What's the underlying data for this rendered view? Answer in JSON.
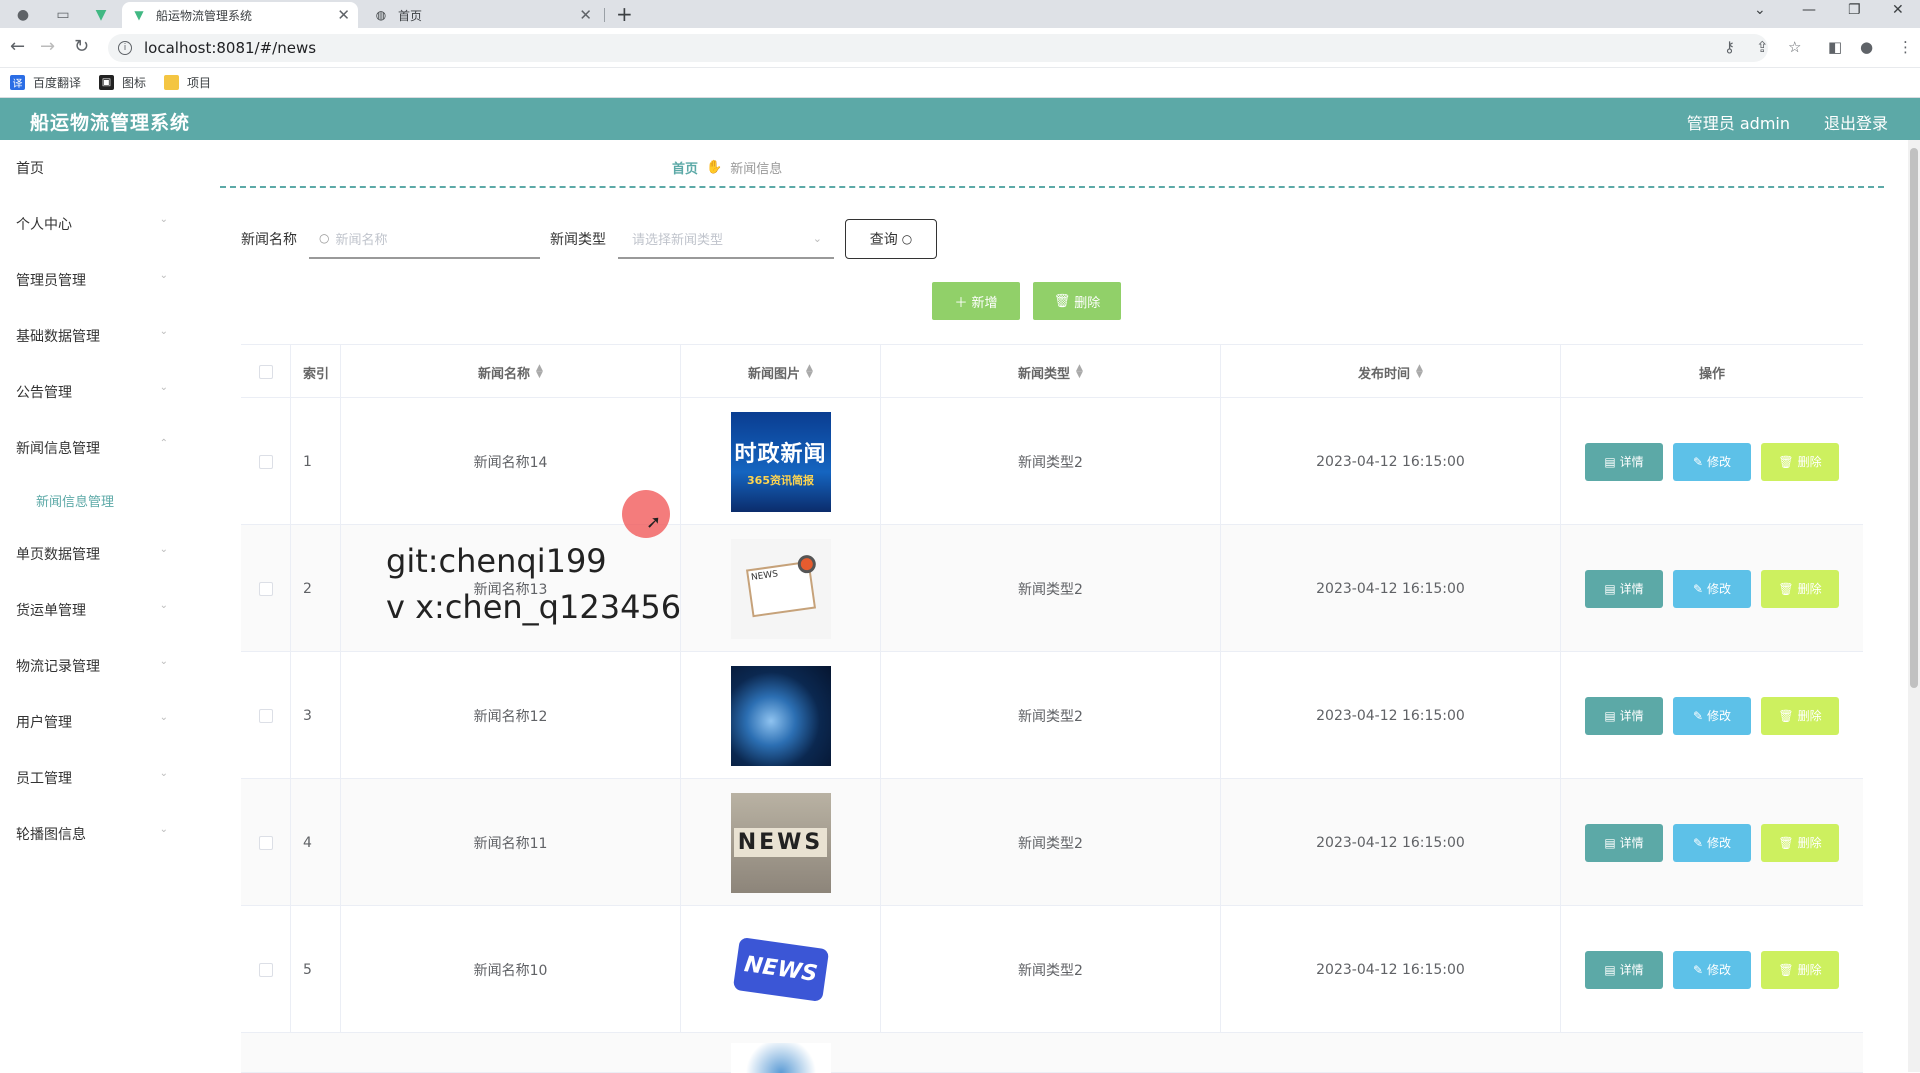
{
  "browser": {
    "active_tab_title": "船运物流管理系统",
    "second_tab_title": "首页",
    "url": "localhost:8081/#/news",
    "bookmarks": [
      "百度翻译",
      "图标",
      "项目"
    ]
  },
  "header": {
    "title": "船运物流管理系统",
    "admin": "管理员 admin",
    "logout": "退出登录"
  },
  "sidebar": {
    "items": [
      "首页",
      "个人中心",
      "管理员管理",
      "基础数据管理",
      "公告管理",
      "新闻信息管理",
      "单页数据管理",
      "货运单管理",
      "物流记录管理",
      "用户管理",
      "员工管理",
      "轮播图信息"
    ],
    "sub_item": "新闻信息管理"
  },
  "breadcrumb": {
    "home": "首页",
    "current": "新闻信息"
  },
  "search": {
    "name_label": "新闻名称",
    "name_placeholder": "新闻名称",
    "type_label": "新闻类型",
    "type_placeholder": "请选择新闻类型",
    "query_button": "查询"
  },
  "actions": {
    "add": "新增",
    "delete": "删除"
  },
  "table": {
    "headers": [
      "索引",
      "新闻名称",
      "新闻图片",
      "新闻类型",
      "发布时间",
      "操作"
    ],
    "rows": [
      {
        "index": "1",
        "name": "新闻名称14",
        "type": "新闻类型2",
        "time": "2023-04-12 16:15:00",
        "image_text": "时政新闻",
        "image_sub": "365资讯简报"
      },
      {
        "index": "2",
        "name": "新闻名称13",
        "type": "新闻类型2",
        "time": "2023-04-12 16:15:00",
        "image_text": "NEWS"
      },
      {
        "index": "3",
        "name": "新闻名称12",
        "type": "新闻类型2",
        "time": "2023-04-12 16:15:00"
      },
      {
        "index": "4",
        "name": "新闻名称11",
        "type": "新闻类型2",
        "time": "2023-04-12 16:15:00",
        "image_text": "NEWS"
      },
      {
        "index": "5",
        "name": "新闻名称10",
        "type": "新闻类型2",
        "time": "2023-04-12 16:15:00",
        "image_text": "NEWS"
      }
    ],
    "row_actions": {
      "detail": "详情",
      "edit": "修改",
      "delete": "删除"
    }
  },
  "watermark": {
    "line1": "git:chenqi199",
    "line2": "v x:chen_q123456"
  }
}
